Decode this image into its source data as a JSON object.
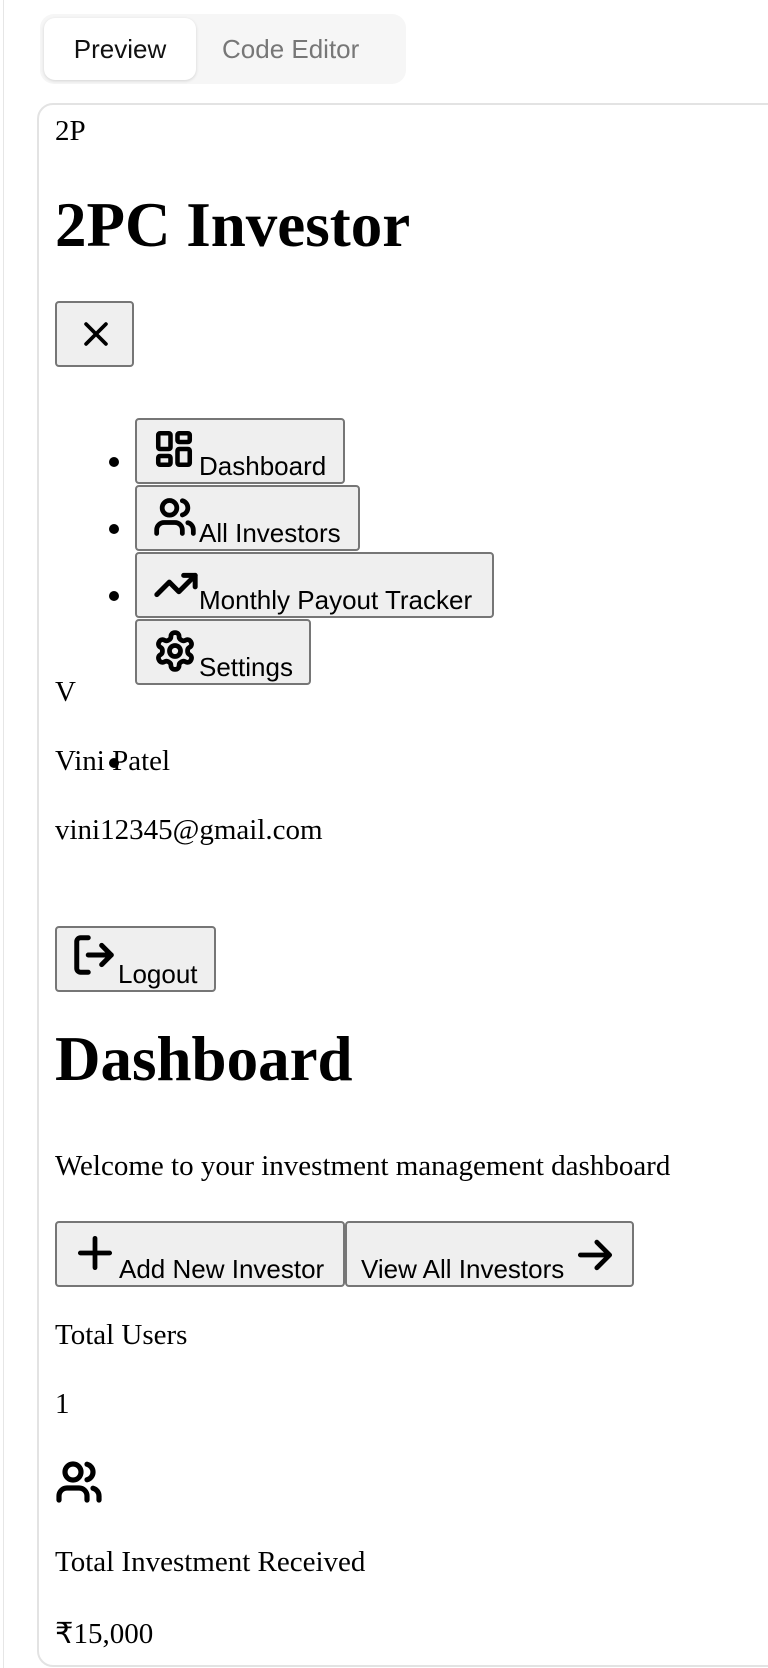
{
  "tabs": {
    "preview": "Preview",
    "code_editor": "Code Editor"
  },
  "app": {
    "logo_initials": "2P",
    "title": "2PC Investor",
    "close_icon": "x-icon"
  },
  "nav": {
    "items": [
      {
        "label": "Dashboard",
        "icon": "dashboard-grid-icon"
      },
      {
        "label": "All Investors",
        "icon": "users-icon"
      },
      {
        "label": "Monthly Payout Tracker",
        "icon": "trending-up-icon"
      },
      {
        "label": "Settings",
        "icon": "gear-icon"
      }
    ]
  },
  "user": {
    "avatar_initial": "V",
    "name": "Vini Patel",
    "email": "vini12345@gmail.com",
    "logout_label": "Logout",
    "logout_icon": "logout-icon"
  },
  "main": {
    "title": "Dashboard",
    "subtitle": "Welcome to your investment management dashboard",
    "add_investor_label": "Add New Investor",
    "view_investors_label": "View All Investors"
  },
  "stats": {
    "total_users_label": "Total Users",
    "total_users_value": "1",
    "total_users_icon": "users-icon",
    "total_investment_label": "Total Investment Received",
    "total_investment_value": "₹15,000"
  }
}
